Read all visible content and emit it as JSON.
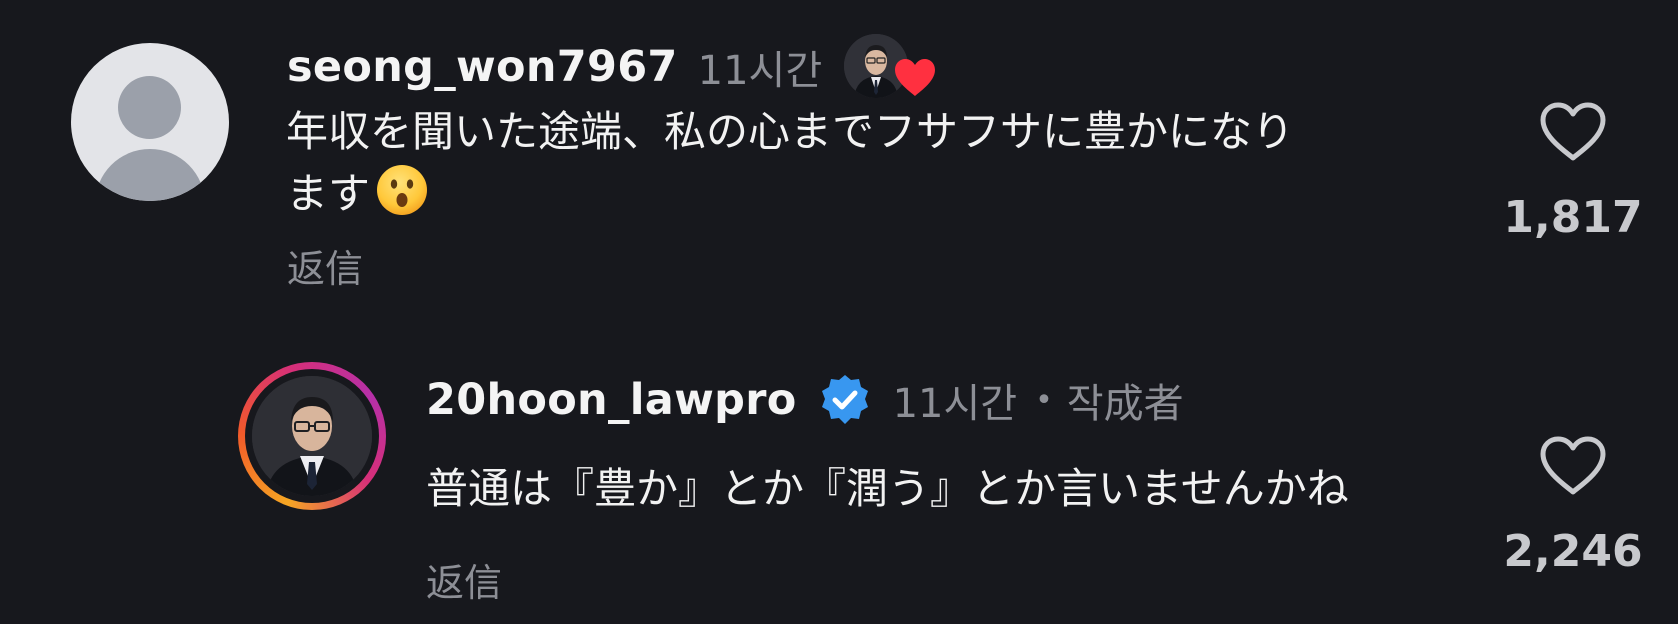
{
  "comments": [
    {
      "username": "seong_won7967",
      "time": "11시간",
      "text_line1": "年収を聞いた途端、私の心までフサフサに豊かになり",
      "text_line2": "ます",
      "emoji": "astonished-face",
      "reply_label": "返信",
      "like_count": "1,817",
      "liked_by_author": true
    },
    {
      "username": "20hoon_lawpro",
      "verified": true,
      "time": "11시간",
      "separator": "•",
      "author_label": "작成者",
      "text": "普通は『豊か』とか『潤う』とか言いませんかね",
      "reply_label": "返信",
      "like_count": "2,246"
    }
  ],
  "colors": {
    "background": "#17181d",
    "text": "#f2f2f2",
    "muted": "#8d8f96",
    "heart_red": "#ff3040",
    "verified_blue": "#3897f0"
  }
}
